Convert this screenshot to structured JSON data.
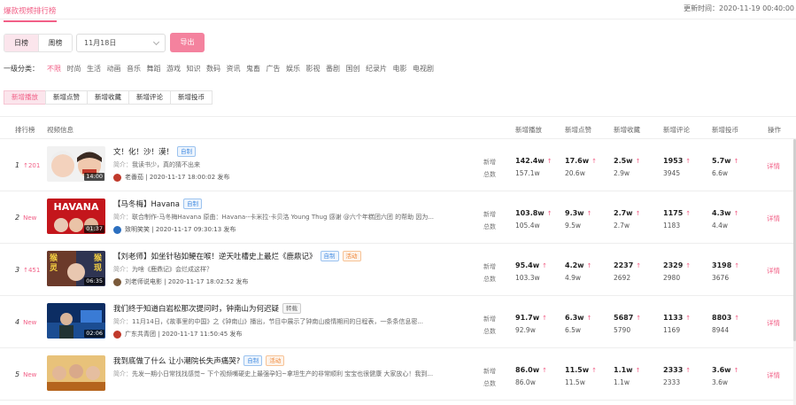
{
  "top_tab": "爆款视频排行榜",
  "update_time": "更新时间：2020-11-19 00:40:00",
  "period_tabs": [
    {
      "label": "日榜",
      "active": true
    },
    {
      "label": "周榜",
      "active": false
    }
  ],
  "date_select": {
    "value": "11月18日"
  },
  "export_label": "导出",
  "category": {
    "label": "一级分类：",
    "items": [
      "不限",
      "时尚",
      "生活",
      "动画",
      "音乐",
      "舞蹈",
      "游戏",
      "知识",
      "数码",
      "资讯",
      "鬼畜",
      "广告",
      "娱乐",
      "影视",
      "番剧",
      "国创",
      "纪录片",
      "电影",
      "电视剧"
    ],
    "active": "不限"
  },
  "metric_tabs": [
    {
      "label": "新增播放",
      "active": true
    },
    {
      "label": "新增点赞",
      "active": false
    },
    {
      "label": "新增收藏",
      "active": false
    },
    {
      "label": "新增评论",
      "active": false
    },
    {
      "label": "新增投币",
      "active": false
    }
  ],
  "columns": {
    "rank": "排行榜",
    "info": "视频信息",
    "play": "新增播放",
    "like": "新增点赞",
    "fav": "新增收藏",
    "comment": "新增评论",
    "coin": "新增投币",
    "action": "操作"
  },
  "row_labels": {
    "added": "新增",
    "total": "总数"
  },
  "intro_label": "简介：",
  "detail_label": "详情",
  "colors": {
    "accent": "#f15f86",
    "export_bg": "#f4829e"
  },
  "rows": [
    {
      "rank": "1",
      "change": "↑201",
      "change_type": "up",
      "duration": "14:00",
      "title": "文！化！沙！漠！",
      "tags": [
        {
          "text": "自制",
          "kind": "blue"
        }
      ],
      "intro": "我读书少，真的猜不出来",
      "author": "老番茄",
      "published": "2020-11-17 18:00:02 发布",
      "thumb": "t1",
      "play": {
        "add": "142.4w",
        "total": "157.1w"
      },
      "like": {
        "add": "17.6w",
        "total": "20.6w"
      },
      "fav": {
        "add": "2.5w",
        "total": "2.9w"
      },
      "comment": {
        "add": "1953",
        "total": "3945"
      },
      "coin": {
        "add": "5.7w",
        "total": "6.6w"
      }
    },
    {
      "rank": "2",
      "change": "New",
      "change_type": "new",
      "duration": "01:37",
      "title": "【马冬梅】Havana",
      "thumb_text": "HAVANA",
      "tags": [
        {
          "text": "自制",
          "kind": "blue"
        }
      ],
      "intro": "联合制作-马冬梅Havana 原曲：Havana--卡米拉·卡贝洛 Young Thug 感谢 @六个年糕团六团 的帮助 因为...",
      "author": "致明笑笑",
      "published": "2020-11-17 09:30:13 发布",
      "thumb": "t2",
      "play": {
        "add": "103.8w",
        "total": "105.4w"
      },
      "like": {
        "add": "9.3w",
        "total": "9.5w"
      },
      "fav": {
        "add": "2.7w",
        "total": "2.7w"
      },
      "comment": {
        "add": "1175",
        "total": "1183"
      },
      "coin": {
        "add": "4.3w",
        "total": "4.4w"
      }
    },
    {
      "rank": "3",
      "change": "↑451",
      "change_type": "up",
      "duration": "06:35",
      "title": "【刘老师】如坐针毡如鲠在喉！逆天吐槽史上最烂《鹿鼎记》",
      "thumb_text_l": "猴灵",
      "thumb_text_r": "猴现",
      "tags": [
        {
          "text": "自制",
          "kind": "blue"
        },
        {
          "text": "活动",
          "kind": "orange"
        }
      ],
      "intro": "为啥《鹿鼎记》会烂成这样？",
      "author": "刘老师说电影",
      "published": "2020-11-17 18:02:52 发布",
      "thumb": "t3",
      "play": {
        "add": "95.4w",
        "total": "103.3w"
      },
      "like": {
        "add": "4.2w",
        "total": "4.9w"
      },
      "fav": {
        "add": "2237",
        "total": "2692"
      },
      "comment": {
        "add": "2329",
        "total": "2980"
      },
      "coin": {
        "add": "3198",
        "total": "3676"
      }
    },
    {
      "rank": "4",
      "change": "New",
      "change_type": "new",
      "duration": "02:06",
      "title": "我们终于知道白岩松那次提问时，钟南山为何迟疑",
      "tags": [
        {
          "text": "转载",
          "kind": "gray"
        }
      ],
      "intro": "11月14日，《故事里的中国》之《钟南山》播出，节目中展示了钟南山疫情期间的日程表，一条条信息密...",
      "author": "广东共青团",
      "published": "2020-11-17 11:50:45 发布",
      "thumb": "t4",
      "play": {
        "add": "91.7w",
        "total": "92.9w"
      },
      "like": {
        "add": "6.3w",
        "total": "6.5w"
      },
      "fav": {
        "add": "5687",
        "total": "5790"
      },
      "comment": {
        "add": "1133",
        "total": "1169"
      },
      "coin": {
        "add": "8803",
        "total": "8944"
      }
    },
    {
      "rank": "5",
      "change": "New",
      "change_type": "new",
      "duration": "",
      "title": "我到底做了什么 让小潮院长失声痛哭?",
      "tags": [
        {
          "text": "自制",
          "kind": "blue"
        },
        {
          "text": "活动",
          "kind": "orange"
        }
      ],
      "intro": "先发一期小日常找找感觉~ 下个视频嘴硬史上最强孕妇~拿坦生产的非常顺利 宝宝也很健康 大家放心！我到...",
      "author": "",
      "published": "",
      "thumb": "t5",
      "play": {
        "add": "86.0w",
        "total": "86.0w"
      },
      "like": {
        "add": "11.5w",
        "total": "11.5w"
      },
      "fav": {
        "add": "1.1w",
        "total": "1.1w"
      },
      "comment": {
        "add": "2333",
        "total": "2333"
      },
      "coin": {
        "add": "3.6w",
        "total": "3.6w"
      }
    }
  ]
}
